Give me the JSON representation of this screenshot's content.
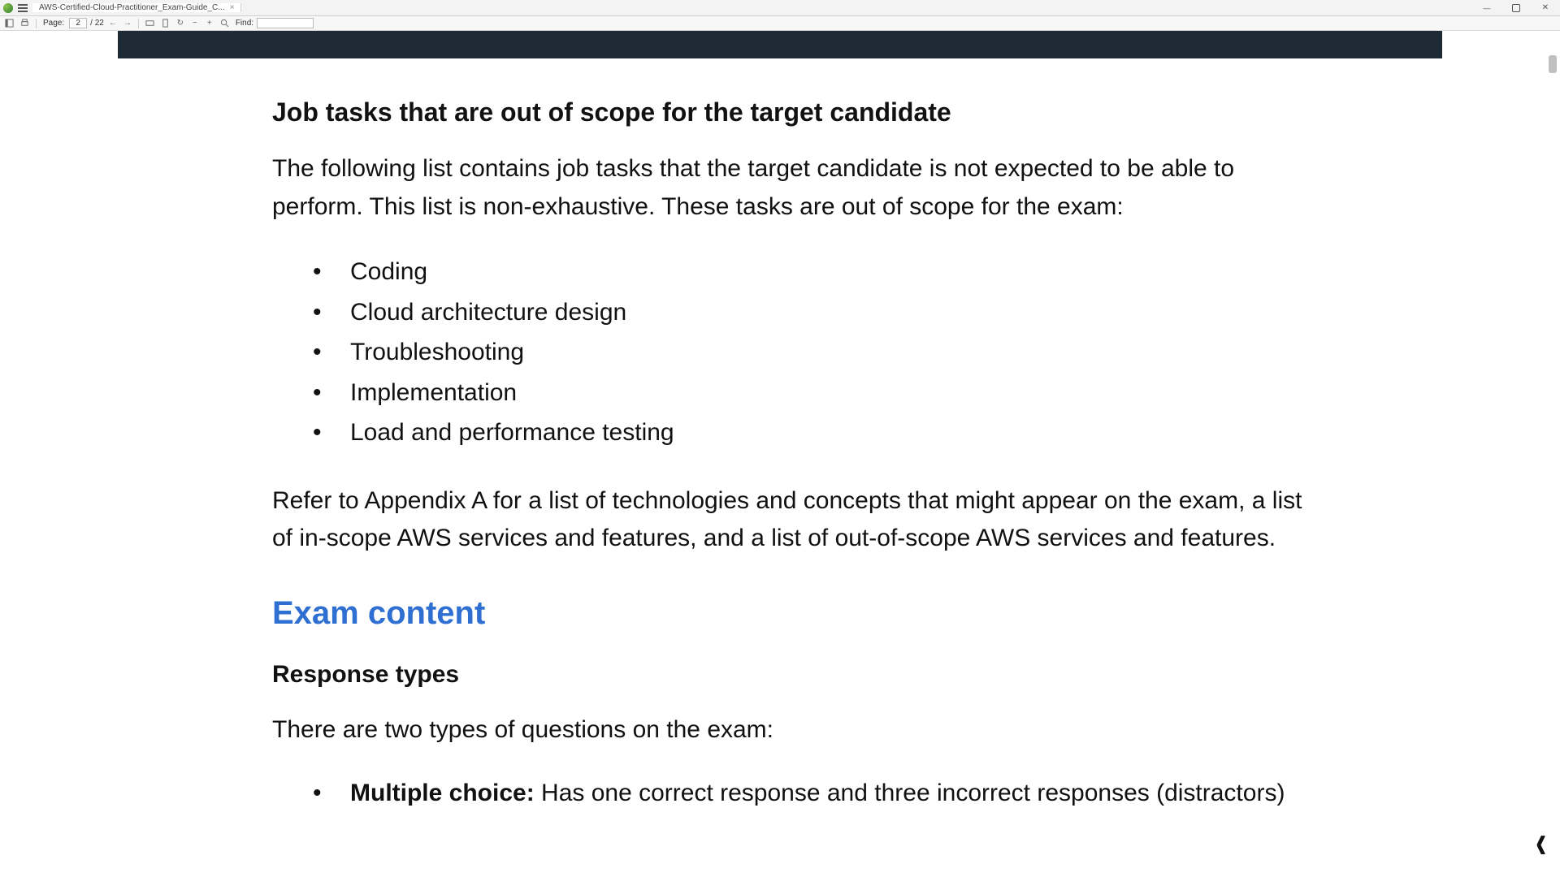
{
  "window": {
    "tab_title": "AWS-Certified-Cloud-Practitioner_Exam-Guide_C...",
    "minimize_tip": "Minimize",
    "maximize_tip": "Maximize",
    "close_tip": "Close"
  },
  "toolbar": {
    "page_label": "Page:",
    "page_current": "2",
    "page_total": "/ 22",
    "find_label": "Find:",
    "find_value": ""
  },
  "doc": {
    "heading_scope": "Job tasks that are out of scope for the target candidate",
    "lead": "The following list contains job tasks that the target candidate is not expected to be able to perform. This list is non-exhaustive. These tasks are out of scope for the exam:",
    "out_of_scope": [
      "Coding",
      "Cloud architecture design",
      "Troubleshooting",
      "Implementation",
      "Load and performance testing"
    ],
    "refer": "Refer to Appendix A for a list of technologies and concepts that might appear on the exam, a list of in-scope AWS services and features, and a list of out-of-scope AWS services and features.",
    "heading_exam": "Exam content",
    "heading_resp": "Response types",
    "two_types": "There are two types of questions on the exam:",
    "qtypes": [
      {
        "label": "Multiple choice:",
        "desc": " Has one correct response and three incorrect responses (distractors)"
      }
    ]
  },
  "icons": {
    "back_chevron": "‹"
  }
}
